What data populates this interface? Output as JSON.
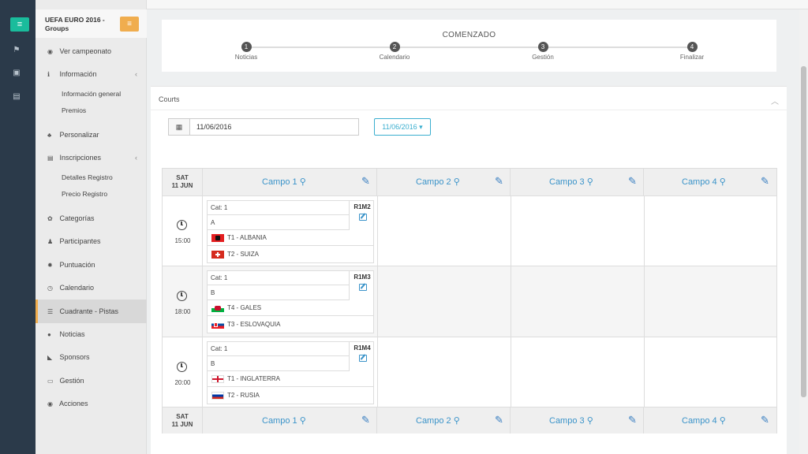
{
  "sidebar": {
    "title": "UEFA EURO 2016 - Groups",
    "items": [
      {
        "label": "Ver campeonato"
      },
      {
        "label": "Información"
      },
      {
        "label": "Información general"
      },
      {
        "label": "Premios"
      },
      {
        "label": "Personalizar"
      },
      {
        "label": "Inscripciones"
      },
      {
        "label": "Detalles Registro"
      },
      {
        "label": "Precio Registro"
      },
      {
        "label": "Categorías"
      },
      {
        "label": "Participantes"
      },
      {
        "label": "Puntuación"
      },
      {
        "label": "Calendario"
      },
      {
        "label": "Cuadrante - Pistas"
      },
      {
        "label": "Noticias"
      },
      {
        "label": "Sponsors"
      },
      {
        "label": "Gestión"
      },
      {
        "label": "Acciones"
      }
    ]
  },
  "wizard": {
    "status": "COMENZADO",
    "steps": [
      {
        "num": "1",
        "label": "Noticias"
      },
      {
        "num": "2",
        "label": "Calendario"
      },
      {
        "num": "3",
        "label": "Gestión"
      },
      {
        "num": "4",
        "label": "Finalizar"
      }
    ]
  },
  "panel": {
    "title": "Courts",
    "date_value": "11/06/2016",
    "date_button": "11/06/2016 ▾"
  },
  "grid": {
    "day_line1": "SAT",
    "day_line2": "11 JUN",
    "courts": [
      "Campo 1",
      "Campo 2",
      "Campo 3",
      "Campo 4"
    ],
    "rows": [
      {
        "time": "15:00",
        "match": {
          "cat": "Cat: 1",
          "group": "A",
          "code": "R1M2",
          "team1": "T1 - ALBANIA",
          "team2": "T2 - SUIZA",
          "flag1": "albania",
          "flag2": "switzerland"
        }
      },
      {
        "time": "18:00",
        "match": {
          "cat": "Cat: 1",
          "group": "B",
          "code": "R1M3",
          "team1": "T4 - GALES",
          "team2": "T3 - ESLOVAQUIA",
          "flag1": "wales",
          "flag2": "slovakia"
        }
      },
      {
        "time": "20:00",
        "match": {
          "cat": "Cat: 1",
          "group": "B",
          "code": "R1M4",
          "team1": "T1 - INGLATERRA",
          "team2": "T2 - RUSIA",
          "flag1": "england",
          "flag2": "russia"
        }
      }
    ]
  },
  "colors": {
    "accent_teal": "#1abc9c",
    "accent_orange": "#f0ad4e",
    "link_blue": "#3a93c9",
    "rail_bg": "#2b3a4a"
  }
}
